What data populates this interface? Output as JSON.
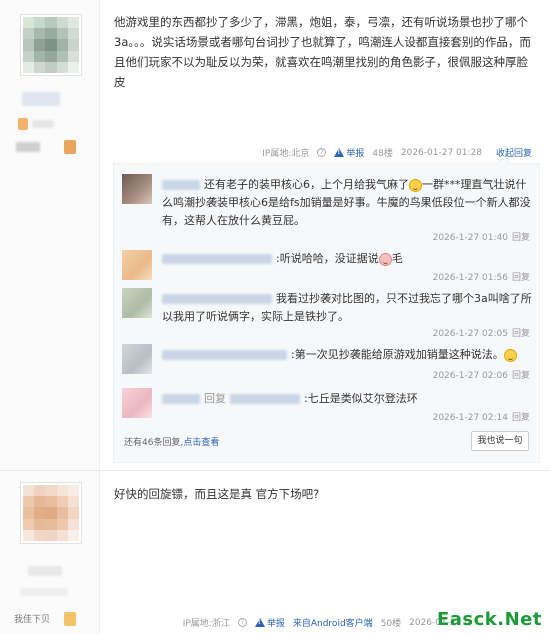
{
  "post1": {
    "content": "他游戏里的东西都抄了多少了，滞黑，炮姐，泰，弓凛，还有听说场景也抄了哪个3a。。。说实话场景或者哪句台词抄了也就算了，鸣潮连人设都直接套别的作品，而且他们玩家不以为耻反以为荣，就喜欢在鸣潮里找别的角色影子，很佩服这种厚脸皮",
    "meta": {
      "ip": "IP属地:北京",
      "report": "举报",
      "floor": "48楼",
      "time": "2026-01-27 01:28",
      "fold": "收起回复"
    },
    "replies": [
      {
        "text": "还有老子的装甲核心6，上个月给我气麻了",
        "text2": "一群***理直气壮说什么鸣潮抄袭装甲核心6是给fs加销量是好事。牛魔的鸟果低段位一个新人都没有，这帮人在放什么黄豆屁。",
        "time": "2026-1-27 01:40",
        "reply": "回复"
      },
      {
        "text": ":听说哈哈，没证据说",
        "text2": "毛",
        "time": "2026-1-27 01:56",
        "reply": "回复"
      },
      {
        "text": "我看过抄袭对比图的，只不过我忘了哪个3a叫啥了所以我用了听说俩字，实际上是铁抄了。",
        "time": "2026-1-27 02:05",
        "reply": "回复"
      },
      {
        "text": ":第一次见抄袭能给原游戏加销量这种说法。",
        "time": "2026-1-27 02:06",
        "reply": "回复"
      },
      {
        "text": "回复",
        "text2": ":七丘是类似艾尔登法环",
        "time": "2026-1-27 02:14",
        "reply": "回复"
      }
    ],
    "more_prefix": "还有46条回复,",
    "more_link": "点击查看",
    "say_button": "我也说一句"
  },
  "post2": {
    "content": "好快的回旋镖，而且这是真 官方下场吧?",
    "meta": {
      "ip": "IP属地:浙江",
      "report": "举报",
      "client": "来自Android客户端",
      "floor": "50楼",
      "time": "2026-01-27 0"
    },
    "user_label": "我佳下贝"
  },
  "watermark": "Easck.Net",
  "colors": {
    "link": "#2d64b3",
    "meta": "#999999",
    "reply_bg": "#f7f8fa",
    "watermark": "#1d9a3b"
  }
}
